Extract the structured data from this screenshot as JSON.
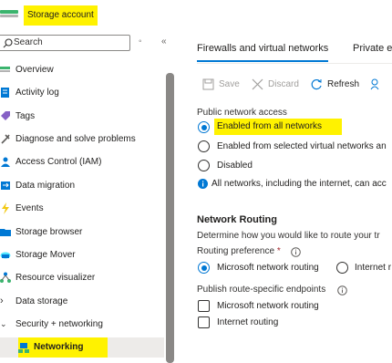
{
  "header": {
    "title": "Storage account",
    "logo_icon": "storage-account-icon"
  },
  "sidebar": {
    "search_placeholder": "Search",
    "items": [
      {
        "label": "Overview",
        "icon": "overview-icon"
      },
      {
        "label": "Activity log",
        "icon": "activity-log-icon"
      },
      {
        "label": "Tags",
        "icon": "tag-icon"
      },
      {
        "label": "Diagnose and solve problems",
        "icon": "wrench-icon"
      },
      {
        "label": "Access Control (IAM)",
        "icon": "people-icon"
      },
      {
        "label": "Data migration",
        "icon": "data-migration-icon"
      },
      {
        "label": "Events",
        "icon": "lightning-icon"
      },
      {
        "label": "Storage browser",
        "icon": "folder-icon"
      },
      {
        "label": "Storage Mover",
        "icon": "cloud-icon"
      },
      {
        "label": "Resource visualizer",
        "icon": "network-icon"
      },
      {
        "label": "Data storage",
        "icon": "chevron-right-icon"
      },
      {
        "label": "Security + networking",
        "icon": "chevron-down-icon"
      },
      {
        "label": "Networking",
        "icon": "networking-icon",
        "selected": true
      }
    ]
  },
  "tabs": [
    {
      "label": "Firewalls and virtual networks",
      "active": true
    },
    {
      "label": "Private e",
      "active": false
    }
  ],
  "toolbar": {
    "save": "Save",
    "discard": "Discard",
    "refresh": "Refresh"
  },
  "public_access": {
    "label": "Public network access",
    "options": [
      "Enabled from all networks",
      "Enabled from selected virtual networks an",
      "Disabled"
    ],
    "selected": 0,
    "info": "All networks, including the internet, can acc"
  },
  "routing": {
    "heading": "Network Routing",
    "description": "Determine how you would like to route your tr",
    "preference_label": "Routing preference",
    "required_mark": "*",
    "options": [
      "Microsoft network routing",
      "Internet r"
    ],
    "selected": 0,
    "publish_label": "Publish route-specific endpoints",
    "checkboxes": [
      "Microsoft network routing",
      "Internet routing"
    ]
  },
  "colors": {
    "accent": "#0078d4",
    "highlight": "#fff200"
  }
}
